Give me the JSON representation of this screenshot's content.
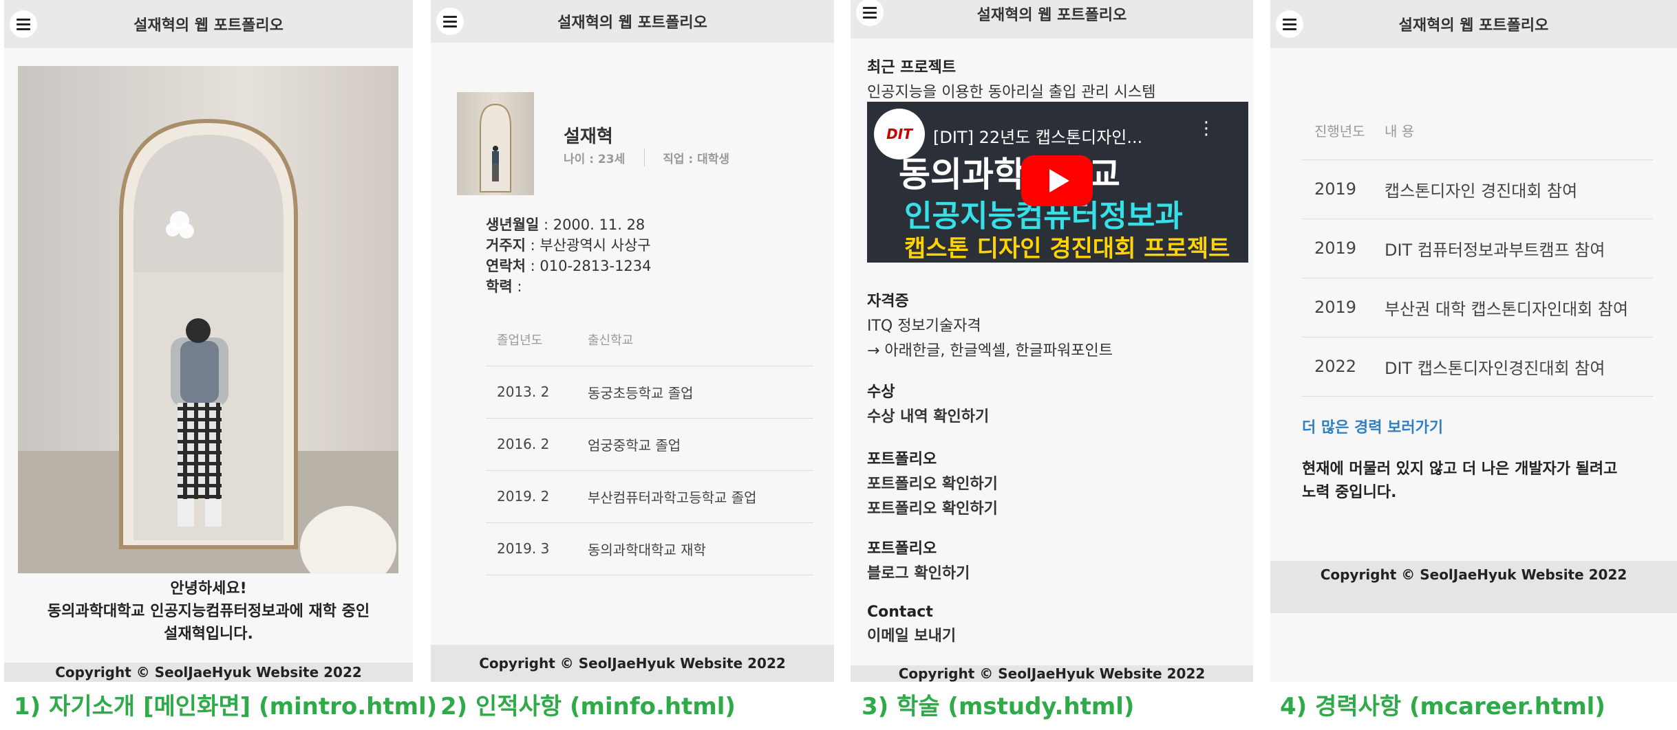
{
  "site_title": "설재혁의 웹 포트폴리오",
  "copyright": "Copyright © SeolJaeHyuk Website 2022",
  "captions": [
    "1) 자기소개 [메인화면] (mintro.html)",
    "2) 인적사항 (minfo.html)",
    "3) 학술 (mstudy.html)",
    "4) 경력사항 (mcareer.html)"
  ],
  "intro": {
    "line1": "안녕하세요!",
    "line2": "동의과학대학교 인공지능컴퓨터정보과에 재학 중인",
    "line3": "설재혁입니다."
  },
  "info": {
    "name": "설재혁",
    "age": "나이 : 23세",
    "job": "직업 : 대학생",
    "birth_label": "생년월일",
    "birth_value": " : 2000. 11. 28",
    "addr_label": "거주지",
    "addr_value": " : 부산광역시 사상구",
    "phone_label": "연락처",
    "phone_value": " : 010-2813-1234",
    "edu_label": "학력",
    "edu_value": " :",
    "table_headers": [
      "졸업년도",
      "출신학교"
    ],
    "rows": [
      {
        "year": "2013. 2",
        "school": "동궁초등학교 졸업"
      },
      {
        "year": "2016. 2",
        "school": "엄궁중학교 졸업"
      },
      {
        "year": "2019. 2",
        "school": "부산컴퓨터과학고등학교 졸업"
      },
      {
        "year": "2019. 3",
        "school": "동의과학대학교 재학"
      }
    ]
  },
  "study": {
    "recent_title": "최근 프로젝트",
    "recent_text": "인공지능을 이용한 동아리실 출입 관리 시스템",
    "video_title": "[DIT] 22년도 캡스톤디자인...",
    "video_logo": "DIT",
    "video_line1": "동의과학대학교",
    "video_line2": "인공지능컴퓨터정보과",
    "video_line3": "캡스톤 디자인 경진대회 프로젝트",
    "cert_title": "자격증",
    "cert_line1": "ITQ 정보기술자격",
    "cert_line2": "→ 아래한글, 한글엑셀, 한글파워포인트",
    "award_title": "수상",
    "award_link": "수상 내역 확인하기",
    "pf_title": "포트폴리오",
    "pf_link1": "포트폴리오 확인하기",
    "pf_link2": "포트폴리오 확인하기",
    "pf2_title": "포트폴리오",
    "blog_link": "블로그 확인하기",
    "contact_title": "Contact",
    "mail_link": "이메일 보내기"
  },
  "career": {
    "headers": [
      "진행년도",
      "내 용"
    ],
    "rows": [
      {
        "year": "2019",
        "content": "캡스톤디자인 경진대회 참여"
      },
      {
        "year": "2019",
        "content": "DIT 컴퓨터정보과부트캠프 참여"
      },
      {
        "year": "2019",
        "content": "부산권 대학 캡스톤디자인대회 참여"
      },
      {
        "year": "2022",
        "content": "DIT 캡스톤디자인경진대회 참여"
      }
    ],
    "more_link": "더 많은 경력 보러가기",
    "closing_line1": "현재에 머물러 있지 않고 더 나은 개발자가 될려고",
    "closing_line2": "노력 중입니다."
  },
  "colors": {
    "link": "#2f7fc1",
    "caption": "#2eab48",
    "header_bg": "#e9e9e9",
    "video_red": "#ff0000",
    "video_cyan": "#36e0e6",
    "video_yellow": "#ffd400"
  }
}
